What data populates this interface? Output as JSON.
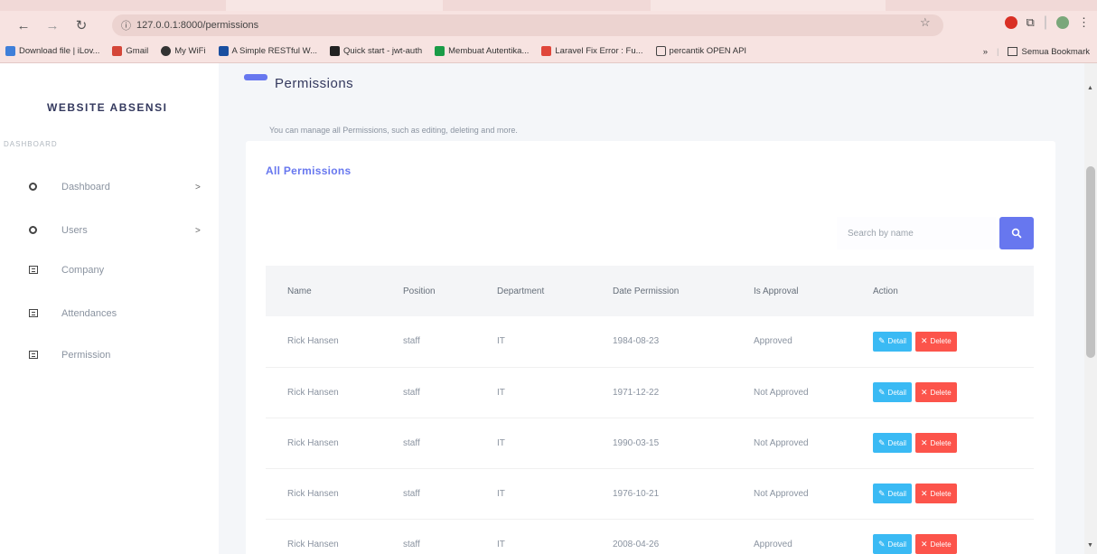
{
  "browser": {
    "url": "127.0.0.1:8000/permissions",
    "bookmarks": [
      "Download file | iLov...",
      "Gmail",
      "My WiFi",
      "A Simple RESTful W...",
      "Quick start - jwt-auth",
      "Membuat Autentika...",
      "Laravel Fix Error : Fu...",
      "percantik OPEN API"
    ],
    "more": "»",
    "all_bookmarks": "Semua Bookmark"
  },
  "sidebar": {
    "brand": "WEBSITE ABSENSI",
    "section": "DASHBOARD",
    "items": [
      {
        "label": "Dashboard",
        "chevron": ">"
      },
      {
        "label": "Users",
        "chevron": ">"
      },
      {
        "label": "Company"
      },
      {
        "label": "Attendances"
      },
      {
        "label": "Permission"
      }
    ]
  },
  "page": {
    "title": "Permissions",
    "description": "You can manage all Permissions, such as editing, deleting and more."
  },
  "card": {
    "title": "All Permissions",
    "search_placeholder": "Search by name"
  },
  "table": {
    "headers": [
      "Name",
      "Position",
      "Department",
      "Date Permission",
      "Is Approval",
      "Action"
    ],
    "rows": [
      {
        "name": "Rick Hansen",
        "position": "staff",
        "department": "IT",
        "date": "1984-08-23",
        "approval": "Approved"
      },
      {
        "name": "Rick Hansen",
        "position": "staff",
        "department": "IT",
        "date": "1971-12-22",
        "approval": "Not Approved"
      },
      {
        "name": "Rick Hansen",
        "position": "staff",
        "department": "IT",
        "date": "1990-03-15",
        "approval": "Not Approved"
      },
      {
        "name": "Rick Hansen",
        "position": "staff",
        "department": "IT",
        "date": "1976-10-21",
        "approval": "Not Approved"
      },
      {
        "name": "Rick Hansen",
        "position": "staff",
        "department": "IT",
        "date": "2008-04-26",
        "approval": "Approved"
      }
    ],
    "detail_label": "Detail",
    "delete_label": "Delete"
  },
  "colors": {
    "primary": "#6777ef",
    "info": "#3abaf4",
    "danger": "#fc544b"
  }
}
